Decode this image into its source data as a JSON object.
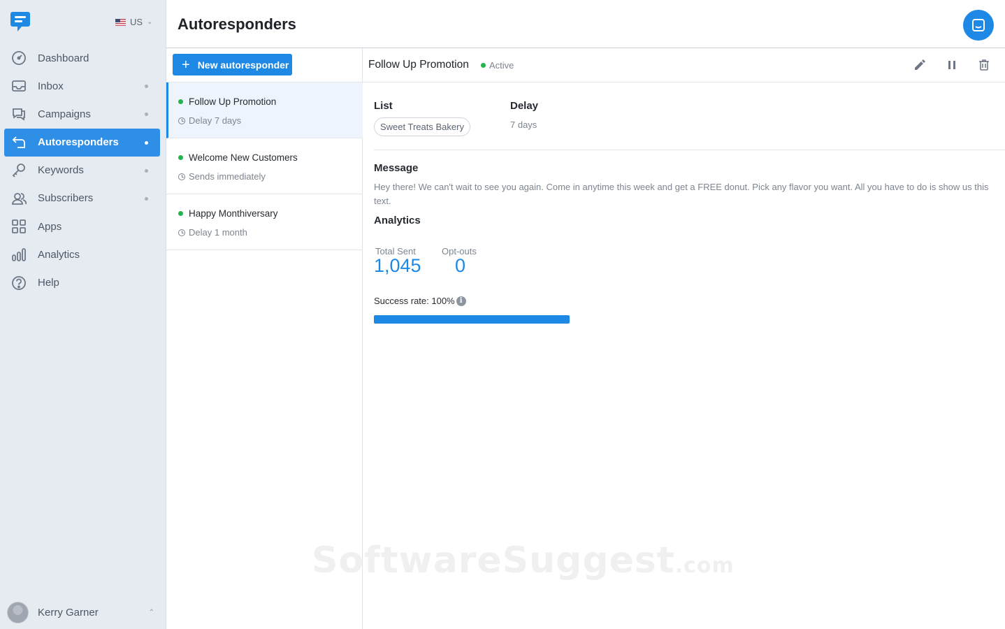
{
  "sidebar": {
    "country": "US",
    "items": [
      {
        "label": "Dashboard",
        "icon": "dashboard-icon",
        "dot": false
      },
      {
        "label": "Inbox",
        "icon": "inbox-icon",
        "dot": true
      },
      {
        "label": "Campaigns",
        "icon": "campaigns-icon",
        "dot": true
      },
      {
        "label": "Autoresponders",
        "icon": "autoresponders-icon",
        "dot": true,
        "active": true
      },
      {
        "label": "Keywords",
        "icon": "key-icon",
        "dot": true
      },
      {
        "label": "Subscribers",
        "icon": "subscribers-icon",
        "dot": true
      },
      {
        "label": "Apps",
        "icon": "apps-icon",
        "dot": false
      },
      {
        "label": "Analytics",
        "icon": "analytics-icon",
        "dot": false
      },
      {
        "label": "Help",
        "icon": "help-icon",
        "dot": false
      }
    ],
    "user_name": "Kerry Garner"
  },
  "header": {
    "title": "Autoresponders"
  },
  "list": {
    "new_button_label": "New autoresponder",
    "items": [
      {
        "title": "Follow Up Promotion",
        "sub": "Delay 7 days",
        "selected": true
      },
      {
        "title": "Welcome New Customers",
        "sub": "Sends immediately"
      },
      {
        "title": "Happy Monthiversary",
        "sub": "Delay 1 month"
      }
    ]
  },
  "detail": {
    "title": "Follow Up Promotion",
    "status": "Active",
    "list_label": "List",
    "list_value": "Sweet Treats Bakery",
    "delay_label": "Delay",
    "delay_value": "7 days",
    "message_label": "Message",
    "message_text": "Hey there! We can't wait to see you again. Come in anytime this week and get a FREE donut. Pick any flavor you want. All you have to do is show us this text.",
    "analytics_label": "Analytics",
    "total_sent_label": "Total Sent",
    "total_sent_value": "1,045",
    "optouts_label": "Opt-outs",
    "optouts_value": "0",
    "success_rate_label": "Success rate: 100%",
    "success_rate": 1.0
  },
  "watermark": {
    "main": "SoftwareSuggest",
    "suffix": ".com"
  },
  "colors": {
    "accent": "#1e88e5",
    "active_green": "#25b34c",
    "sidebar_bg": "#e6ebf2"
  }
}
